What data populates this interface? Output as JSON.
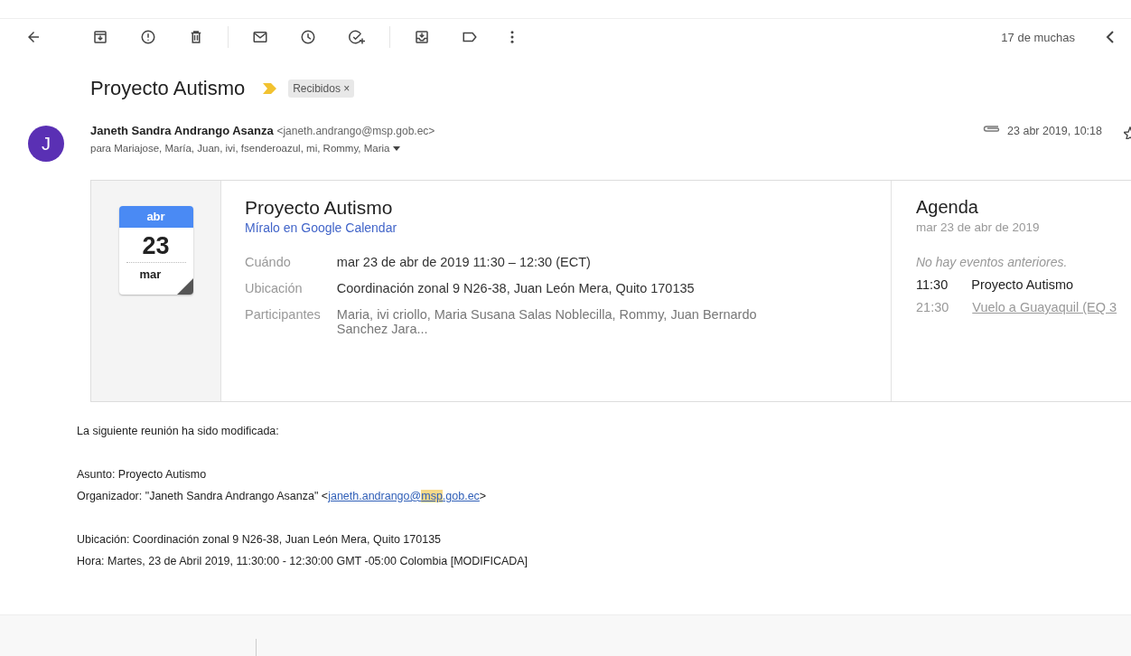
{
  "toolbar": {
    "counter": "17 de muchas"
  },
  "subject": {
    "title": "Proyecto Autismo",
    "important": true,
    "labels": [
      {
        "text": "Recibidos",
        "close": "×"
      }
    ]
  },
  "message": {
    "avatar": "J",
    "sender": "Janeth Sandra Andrango Asanza",
    "email": "<janeth.andrango@msp.gob.ec>",
    "recipients": "para Mariajose, María, Juan, ivi, fsenderoazul, mi, Rommy, Maria",
    "attachment": true,
    "date": "23 abr 2019, 10:18"
  },
  "invite": {
    "calendar": {
      "month": "abr",
      "day": "23",
      "weekday": "mar"
    },
    "title": "Proyecto Autismo",
    "link": "Míralo en Google Calendar",
    "details": [
      {
        "label": "Cuándo",
        "value": "mar 23 de abr de 2019 11:30 – 12:30 (ECT)"
      },
      {
        "label": "Ubicación",
        "value": "Coordinación zonal 9 N26-38, Juan León Mera, Quito 170135"
      },
      {
        "label": "Participantes",
        "value": "Maria, ivi criollo, Maria Susana Salas Noblecilla, Rommy, Juan Bernardo Sanchez Jara..."
      }
    ],
    "agenda": {
      "title": "Agenda",
      "date": "mar 23 de abr de 2019",
      "empty": "No hay eventos anteriores.",
      "events": [
        {
          "time": "11:30",
          "name": "Proyecto Autismo",
          "current": true
        },
        {
          "time": "21:30",
          "name": "Vuelo a Guayaquil (EQ 3",
          "current": false
        }
      ]
    }
  },
  "body": {
    "intro": "La siguiente reunión ha sido modificada:",
    "subject": "Asunto: Proyecto Autismo",
    "organizer": {
      "prefix": "Organizador: \"Janeth Sandra Andrango Asanza\" <",
      "link_before": "janeth.andrango@",
      "link_highlight": "msp",
      "link_after": ".gob.ec",
      "suffix": ">"
    },
    "location": "Ubicación: Coordinación zonal 9 N26-38, Juan León Mera, Quito 170135",
    "time": "Hora: Martes, 23 de Abril 2019, 11:30:00 - 12:30:00 GMT -05:00 Colombia [MODIFICADA]"
  }
}
